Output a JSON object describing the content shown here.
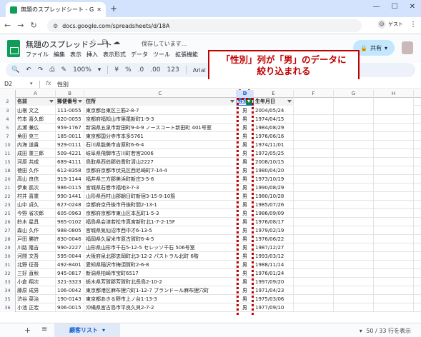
{
  "browser": {
    "tab_title": "無題のスプレッドシート - Google ス",
    "tab_close": "✕",
    "new_tab": "+",
    "url": "docs.google.com/spreadsheets/d/18A",
    "guest_label": "ゲスト"
  },
  "app": {
    "doc_title": "無題のスプレッドシート",
    "saved_status": "保存しています...",
    "menu": [
      "ファイル",
      "編集",
      "表示",
      "挿入",
      "表示形式",
      "データ",
      "ツール",
      "拡張機能"
    ],
    "share_label": "共有"
  },
  "toolbar": {
    "zoom": "100%",
    "currency": "¥",
    "percent": "%",
    "decimal_decrease": ".0",
    "decimal_increase": ".00",
    "number_format": "123",
    "font": "Arial"
  },
  "formula_bar": {
    "cell_ref": "D2",
    "content": "性別"
  },
  "grid": {
    "columns": [
      "A",
      "B",
      "C",
      "D",
      "E",
      "F",
      "G",
      "H"
    ],
    "selected_column": "D",
    "header": {
      "row_number": "2",
      "cells": [
        "名前",
        "郵便番号",
        "住所",
        "性別",
        "生年月日"
      ]
    },
    "rows": [
      {
        "n": "3",
        "name": "山根 文之",
        "zip": "111-0055",
        "addr": "東京都台東区三筋2-8-7",
        "sex": "男",
        "birth": "2004/05/24"
      },
      {
        "n": "4",
        "name": "竹本 喜久郎",
        "zip": "620-0055",
        "addr": "京都府福知山市篠尾新町1-9-3",
        "sex": "男",
        "birth": "1974/04/15"
      },
      {
        "n": "5",
        "name": "広瀬 兼広",
        "zip": "959-1767",
        "addr": "新潟県五泉市新田町9-4-9 ノースコート新田町 401号室",
        "sex": "男",
        "birth": "1984/08/29"
      },
      {
        "n": "7",
        "name": "角田 克三",
        "zip": "185-0011",
        "addr": "東京都国分寺市本多5761",
        "sex": "男",
        "birth": "1976/06/16"
      },
      {
        "n": "10",
        "name": "内海 道貴",
        "zip": "929-0111",
        "addr": "石川県能美市吉原町6-6-4",
        "sex": "男",
        "birth": "1974/11/01"
      },
      {
        "n": "11",
        "name": "成田 重三郎",
        "zip": "509-4221",
        "addr": "岐阜県飛騨市古川町若宮2006",
        "sex": "男",
        "birth": "1972/05/25"
      },
      {
        "n": "15",
        "name": "河原 共成",
        "zip": "689-4111",
        "addr": "鳥取県西伯郡伯耆町清山2227",
        "sex": "男",
        "birth": "2008/10/15"
      },
      {
        "n": "18",
        "name": "徳田 久作",
        "zip": "612-8358",
        "addr": "京都府京都市伏見区西尼崎町7-14-4",
        "sex": "男",
        "birth": "1980/04/20"
      },
      {
        "n": "20",
        "name": "高山 良信",
        "zip": "919-1144",
        "addr": "福井県三方郡美浜町新庄3-5-6",
        "sex": "男",
        "birth": "1973/10/19"
      },
      {
        "n": "21",
        "name": "伊東 凱次",
        "zip": "986-0115",
        "addr": "宮城県石巻市福地3-7-3",
        "sex": "男",
        "birth": "1990/08/29"
      },
      {
        "n": "22",
        "name": "村井 喜重",
        "zip": "990-1441",
        "addr": "山形県西村山郡朝日町新宿3-15-9-10筋",
        "sex": "男",
        "birth": "1980/10/28"
      },
      {
        "n": "23",
        "name": "山中 貞久",
        "zip": "627-0248",
        "addr": "京都府京丹後市丹後町間2-13-1",
        "sex": "男",
        "birth": "1985/07/26"
      },
      {
        "n": "25",
        "name": "今野 省次郎",
        "zip": "605-0963",
        "addr": "京都府京都市東山区本瓦町1-5-3",
        "sex": "男",
        "birth": "1986/09/09"
      },
      {
        "n": "26",
        "name": "鈴木 星具",
        "zip": "965-0102",
        "addr": "福島県会津若松市真宮新町北1-7-2-15F",
        "sex": "男",
        "birth": "1976/08/17"
      },
      {
        "n": "27",
        "name": "森山 久作",
        "zip": "988-0805",
        "addr": "宮城県気仙沼市西中才6-13-5",
        "sex": "男",
        "birth": "1979/02/19"
      },
      {
        "n": "28",
        "name": "戸田 勝許",
        "zip": "830-0046",
        "addr": "福岡県久留米市原古賀町6-4-5",
        "sex": "男",
        "birth": "1976/06/22"
      },
      {
        "n": "29",
        "name": "川路 隆吉",
        "zip": "990-2227",
        "addr": "山形県山形市千石5-12-5 セレッソ千石 506号室",
        "sex": "男",
        "birth": "1987/12/27"
      },
      {
        "n": "30",
        "name": "河間 文吾",
        "zip": "595-0044",
        "addr": "大阪府泉北郡忠岡町北3-12-2 パストラル北町 6階",
        "sex": "男",
        "birth": "1993/03/12"
      },
      {
        "n": "31",
        "name": "北野 征吾",
        "zip": "492-8401",
        "addr": "愛知県稲沢市梅須賀町2-6-8",
        "sex": "男",
        "birth": "1988/11/14"
      },
      {
        "n": "32",
        "name": "三好 直秋",
        "zip": "945-0817",
        "addr": "新潟県柏崎市宝町6517",
        "sex": "男",
        "birth": "1976/01/24"
      },
      {
        "n": "33",
        "name": "小倉 翔次",
        "zip": "321-3323",
        "addr": "栃木県芳賀郡芳賀町北長島2-10-2",
        "sex": "男",
        "birth": "1997/09/20"
      },
      {
        "n": "34",
        "name": "藤原 成男",
        "zip": "106-0042",
        "addr": "東京都港区麻布狸穴町1-12-7 ブランドール麻布狸穴町",
        "sex": "男",
        "birth": "1971/04/23"
      },
      {
        "n": "35",
        "name": "渋谷 菜治",
        "zip": "190-0143",
        "addr": "東京都あきる野市上ノ台1-13-3",
        "sex": "男",
        "birth": "1975/03/06"
      },
      {
        "n": "36",
        "name": "小池 正宏",
        "zip": "906-0015",
        "addr": "沖縄県宮古島市平良久貝2-7-2",
        "sex": "男",
        "birth": "1977/09/10"
      }
    ]
  },
  "callout": {
    "line1": "「性別」列が「男」のデータに",
    "line2": "絞り込まれる"
  },
  "colors": {
    "accent": "#c00000",
    "filter_active": "#188038",
    "brand": "#0f9d58"
  },
  "sheets": {
    "add_label": "+",
    "all_sheets_label": "≡",
    "active_sheet": "顧客リスト",
    "count_text": "50 / 33 行を表示"
  }
}
